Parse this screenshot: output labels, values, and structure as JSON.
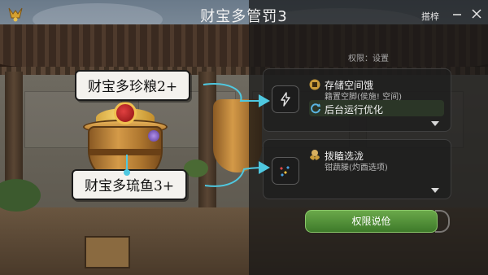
{
  "window": {
    "title": "财宝多管罚3",
    "top_link": "搭梓",
    "minimize_label": "—",
    "close_label": "✕"
  },
  "settings": {
    "section_label": "权限：设置",
    "cards": [
      {
        "title": "存储空间饿",
        "description": "籍置空脚(侯施! 空间)",
        "sub_option": "后台运行优化",
        "icon": "lightning-icon"
      },
      {
        "title": "拨瞌选泷",
        "description": "钳蔬滕(灼酉选项)",
        "icon": "sparkle-icon"
      }
    ],
    "cta_label": "权限说伧"
  },
  "callouts": {
    "top": "财宝多珍粮2+",
    "bottom": "财宝多琉鱼3+"
  },
  "colors": {
    "accent_green": "#4a8a34",
    "arrow_cyan": "#4fc8e0",
    "overlay": "#161616"
  }
}
